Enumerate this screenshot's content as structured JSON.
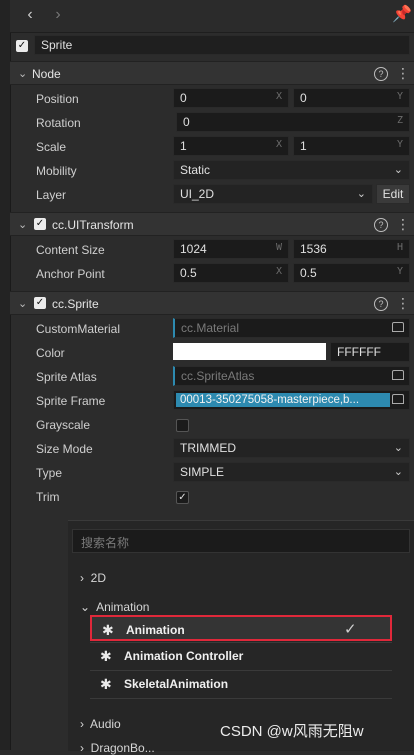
{
  "component_name": "Sprite",
  "node": {
    "title": "Node",
    "rows": [
      {
        "label": "Position",
        "a": "0",
        "a_suffix": "X",
        "b": "0",
        "b_suffix": "Y"
      },
      {
        "label": "Rotation",
        "value": "0",
        "suffix": "Z"
      },
      {
        "label": "Scale",
        "a": "1",
        "a_suffix": "X",
        "b": "1",
        "b_suffix": "Y"
      },
      {
        "label": "Mobility",
        "value": "Static"
      },
      {
        "label": "Layer",
        "value": "UI_2D",
        "button": "Edit"
      }
    ]
  },
  "uitransform": {
    "title": "cc.UITransform",
    "rows": [
      {
        "label": "Content Size",
        "a": "1024",
        "a_suffix": "W",
        "b": "1536",
        "b_suffix": "H"
      },
      {
        "label": "Anchor Point",
        "a": "0.5",
        "a_suffix": "X",
        "b": "0.5",
        "b_suffix": "Y"
      }
    ]
  },
  "sprite": {
    "title": "cc.Sprite",
    "custom_material": {
      "label": "CustomMaterial",
      "value": "cc.Material"
    },
    "color": {
      "label": "Color",
      "hex": "FFFFFF",
      "swatch": "#ffffff"
    },
    "sprite_atlas": {
      "label": "Sprite Atlas",
      "value": "cc.SpriteAtlas"
    },
    "sprite_frame": {
      "label": "Sprite Frame",
      "value": "00013-350275058-masterpiece,b..."
    },
    "grayscale": {
      "label": "Grayscale",
      "checked": false
    },
    "size_mode": {
      "label": "Size Mode",
      "value": "TRIMMED"
    },
    "type": {
      "label": "Type",
      "value": "SIMPLE"
    },
    "trim": {
      "label": "Trim",
      "checked": true
    }
  },
  "popup": {
    "search_placeholder": "搜索名称",
    "categories": [
      "2D",
      "Animation",
      "Audio",
      "DragonBo..."
    ],
    "animation_items": [
      "Animation",
      "Animation Controller",
      "SkeletalAnimation"
    ]
  },
  "watermark": "CSDN @w风雨无阻w",
  "colors": {
    "highlight_border": "#e0283a",
    "selected_field": "#2d8ab0"
  }
}
